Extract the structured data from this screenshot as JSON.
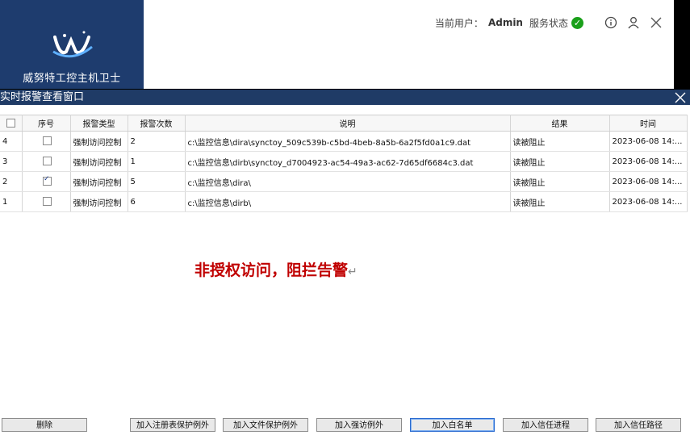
{
  "header": {
    "app_name": "威努特工控主机卫士",
    "user_label": "当前用户：",
    "user_name": "Admin",
    "service_label": "服务状态",
    "ok_glyph": "✓",
    "status_color": "#1aa01a",
    "icons": [
      "info-icon",
      "user-icon",
      "close-icon"
    ]
  },
  "window": {
    "title": "实时报警查看窗口"
  },
  "table": {
    "columns": [
      "",
      "序号",
      "报警类型",
      "报警次数",
      "说明",
      "结果",
      "时间"
    ],
    "rows": [
      {
        "id": "4",
        "checked": false,
        "type": "强制访问控制",
        "count": "2",
        "desc": "c:\\监控信息\\dira\\synctoy_509c539b-c5bd-4beb-8a5b-6a2f5fd0a1c9.dat",
        "result": "读被阻止",
        "time": "2023-06-08 14:..."
      },
      {
        "id": "3",
        "checked": false,
        "type": "强制访问控制",
        "count": "1",
        "desc": "c:\\监控信息\\dirb\\synctoy_d7004923-ac54-49a3-ac62-7d65df6684c3.dat",
        "result": "读被阻止",
        "time": "2023-06-08 14:..."
      },
      {
        "id": "2",
        "checked": true,
        "type": "强制访问控制",
        "count": "5",
        "desc": "c:\\监控信息\\dira\\",
        "result": "读被阻止",
        "time": "2023-06-08 14:..."
      },
      {
        "id": "1",
        "checked": false,
        "type": "强制访问控制",
        "count": "6",
        "desc": "c:\\监控信息\\dirb\\",
        "result": "读被阻止",
        "time": "2023-06-08 14:..."
      }
    ]
  },
  "annotation": {
    "text": "非授权访问，阻拦告警",
    "mark": "↵",
    "color": "#c00000"
  },
  "buttons": {
    "delete": "删除",
    "add_registry_exception": "加入注册表保护例外",
    "add_file_exception": "加入文件保护例外",
    "add_mac_exception": "加入强访例外",
    "add_whitelist": "加入白名单",
    "add_trusted_process": "加入信任进程",
    "add_trusted_path": "加入信任路径"
  }
}
